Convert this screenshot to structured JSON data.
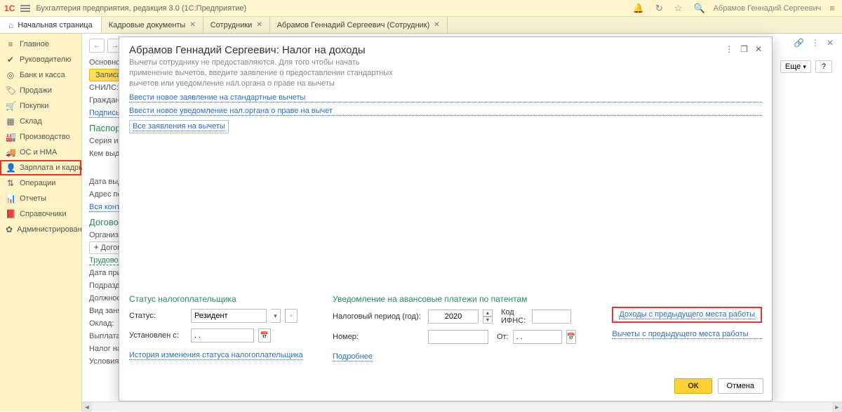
{
  "titlebar": {
    "logo": "1C",
    "app_title": "Бухгалтерия предприятия, редакция 3.0  (1С:Предприятие)",
    "user": "Абрамов Геннадий Сергеевич"
  },
  "tabs": {
    "home": "Начальная страница",
    "items": [
      {
        "label": "Кадровые документы"
      },
      {
        "label": "Сотрудники"
      },
      {
        "label": "Абрамов Геннадий Сергеевич (Сотрудник)"
      }
    ]
  },
  "sidebar": {
    "items": [
      {
        "icon": "≡",
        "label": "Главное"
      },
      {
        "icon": "✔",
        "label": "Руководителю"
      },
      {
        "icon": "◎",
        "label": "Банк и касса"
      },
      {
        "icon": "🏷",
        "label": "Продажи"
      },
      {
        "icon": "🛒",
        "label": "Покупки"
      },
      {
        "icon": "▦",
        "label": "Склад"
      },
      {
        "icon": "🏭",
        "label": "Производство"
      },
      {
        "icon": "🚚",
        "label": "ОС и НМА"
      },
      {
        "icon": "👤",
        "label": "Зарплата и кадры"
      },
      {
        "icon": "⇅",
        "label": "Операции"
      },
      {
        "icon": "📊",
        "label": "Отчеты"
      },
      {
        "icon": "📕",
        "label": "Справочники"
      },
      {
        "icon": "✿",
        "label": "Администрирование"
      }
    ]
  },
  "under": {
    "main_tab": "Основно",
    "save_btn": "Записат",
    "snils": "СНИЛС:",
    "citizenship": "Гражданс",
    "sign": "Подпись",
    "passport_hdr": "Паспорт",
    "series": "Серия и но",
    "issued_by": "Кем выдан",
    "issue_date": "Дата выда",
    "address": "Адрес по п",
    "all_contacts": "Вся конта",
    "contract_hdr": "Договор",
    "org": "Организац",
    "add_contract": "Догово",
    "labor": "Трудовой д",
    "hire_date": "Дата приеі",
    "dept": "Подраздел",
    "position": "Должності",
    "emp_type": "Вид занят",
    "salary": "Оклад:",
    "payout": "Выплата:",
    "tax": "Налог на д",
    "conditions": "Условия с",
    "more_btn": "Еще",
    "help_btn": "?"
  },
  "modal": {
    "title": "Абрамов Геннадий Сергеевич: Налог на доходы",
    "sub": "Вычеты сотруднику не предоставляются. Для того чтобы начать применение вычетов, введите заявление о предоставлении стандартных вычетов или уведомление нал.органа о праве на вычеты",
    "link1": "Ввести новое заявление на стандартные вычеты",
    "link2": "Ввести новое уведомление нал.органа о праве на вычет",
    "link3": "Все заявления на вычеты",
    "sec_status_title": "Статус налогоплательщика",
    "status_label": "Статус:",
    "status_value": "Резидент",
    "set_from_label": "Установлен с:",
    "set_from_value": ". .",
    "status_history": "История изменения статуса налогоплательщика",
    "sec_notice_title": "Уведомление на авансовые платежи по патентам",
    "tax_year_label": "Налоговый период (год):",
    "tax_year_value": "2020",
    "ifns_label": "Код ИФНС:",
    "ifns_value": "",
    "number_label": "Номер:",
    "number_value": "",
    "from_label": "От:",
    "from_value": ". .",
    "details": "Подробнее",
    "income_prev": "Доходы с предыдущего места работы",
    "deduct_prev": "Вычеты с предыдущего места работы",
    "ok": "ОК",
    "cancel": "Отмена"
  }
}
